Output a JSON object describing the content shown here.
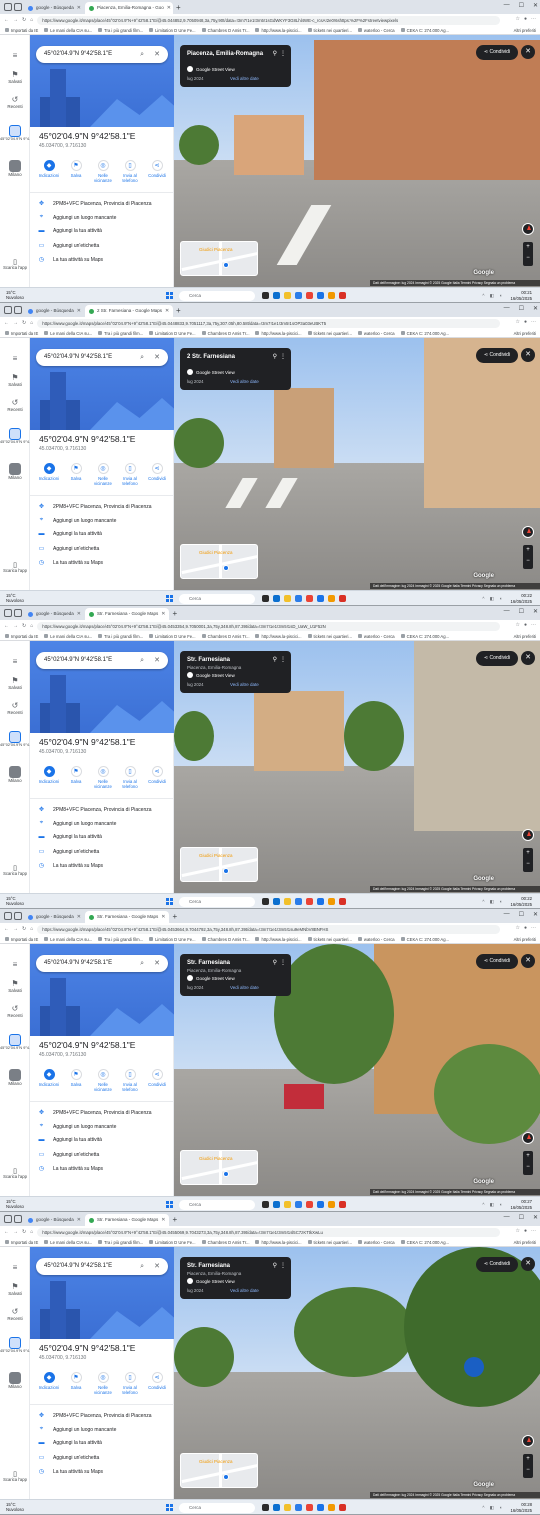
{
  "browser": {
    "tab_search": "google - Búsqueda",
    "tab_maps": [
      "Piacenza, Emilia-Romagna - Goo",
      "2 Str. Farnesiana - Google Maps",
      "Str. Farnesiana - Google Maps",
      "Str. Farnesiana - Google Maps",
      "Str. Farnesiana - Google Maps"
    ],
    "urls": [
      "https://www.google.it/maps/place/45°02'04.9\"N+9°42'58.1\"E/@45.044852,9.7050948,3a,75y,90t/data=!3m7!1e1!3m5!1sGdWKYF3G8Lhl4WE-c_rcsA!2e0!6shttps:%2F%2Fstreetviewpixels",
      "https://www.google.it/maps/place/45°02'04.9\"N+9°42'58.1\"E/@45.0448833,9.7051117,3a,75y,307.05h,80.58t/data=!3m7!1e1!3m5!1sOP3a03eUBKT5",
      "https://www.google.it/maps/place/45°02'04.9\"N+9°42'58.1\"E/@45.0453354,9.7050001,3a,75y,348.8h,87.39t/data=!3m7!1e1!3m5!1sD_UaW_U1F52N",
      "https://www.google.it/maps/place/45°02'04.9\"N+9°42'58.1\"E/@45.0453664,9.7044792,3a,75y,348.8h,87.39t/data=!3m7!1e1!3m5!1su9eMNbV8BNFHS",
      "https://www.google.it/maps/place/45°02'04.9\"N+9°42'58.1\"E/@45.0455069,9.7043273,3a,75y,348.8h,87.39t/data=!3m7!1e1!3m5!1sl5C7zKTtkXwLu"
    ],
    "bookmarks": [
      "Importati da IE",
      "Le mani della CIA su...",
      "Tra i più grandi film...",
      "Limitation D Une Fe...",
      "Chambres D Amis Tr...",
      "http://www.la-piscici...",
      "tickets nei quartieri...",
      "waterloo - Cerca",
      "CEKA C: 274.000 Ag..."
    ],
    "bookmarks_other": "Altri preferiti"
  },
  "rail": {
    "menu_icon": "menu-icon",
    "saved": "Salvati",
    "recent": "Recenti",
    "coord_short": "45°02'04.9\"N 9°4...",
    "milano": "Milano",
    "download": "Scarica l'app"
  },
  "panel": {
    "search_value": "45°02'04.9\"N 9°42'58.1\"E",
    "title": "45°02'04.9\"N 9°42'58.1\"E",
    "subtitle": "45.034700, 9.716130",
    "actions": [
      "Indicazioni",
      "Salva",
      "Nelle vicinanze",
      "Invia al telefono",
      "Condividi"
    ],
    "plus_code": "2PM8+VFC Piacenza, Provincia di Piacenza",
    "add_place": "Aggiungi un luogo mancante",
    "add_business": "Aggiungi la tua attività",
    "add_label": "Aggiungi un'etichetta",
    "your_business": "La tua attività su Maps"
  },
  "streetview": [
    {
      "title": "Piacenza, Emilia-Romagna",
      "subtitle": "",
      "date": "lug 2024",
      "more": "Vedi altre date"
    },
    {
      "title": "2 Str. Farnesiana",
      "subtitle": "",
      "date": "lug 2024",
      "more": "Vedi altre date"
    },
    {
      "title": "Str. Farnesiana",
      "subtitle": "Piacenza, Emilia-Romagna",
      "date": "lug 2024",
      "more": "Vedi altre date"
    },
    {
      "title": "Str. Farnesiana",
      "subtitle": "Piacenza, Emilia-Romagna",
      "date": "lug 2024",
      "more": "Vedi altre date"
    },
    {
      "title": "Str. Farnesiana",
      "subtitle": "Piacenza, Emilia-Romagna",
      "date": "lug 2024",
      "more": "Vedi altre date"
    }
  ],
  "sv_common": {
    "badge": "Google Street View",
    "share": "Condividi",
    "minimap_label": "Giudici Piacenza",
    "logo": "Google",
    "attribution": "Dati dell'immagine: lug 2024   Immagini © 2025 Google   Italia   Termini   Privacy   Segnala un problema"
  },
  "taskbar": {
    "weather_temp": "15°C",
    "weather_desc": "Nuvoloso",
    "search": "Cerca",
    "times": [
      "00:21",
      "00:22",
      "00:22",
      "00:27",
      "00:28"
    ],
    "date": "16/05/2025"
  },
  "colors": {
    "accent": "#1a73e8",
    "hero": "#4d84e6",
    "dark": "#202124"
  }
}
